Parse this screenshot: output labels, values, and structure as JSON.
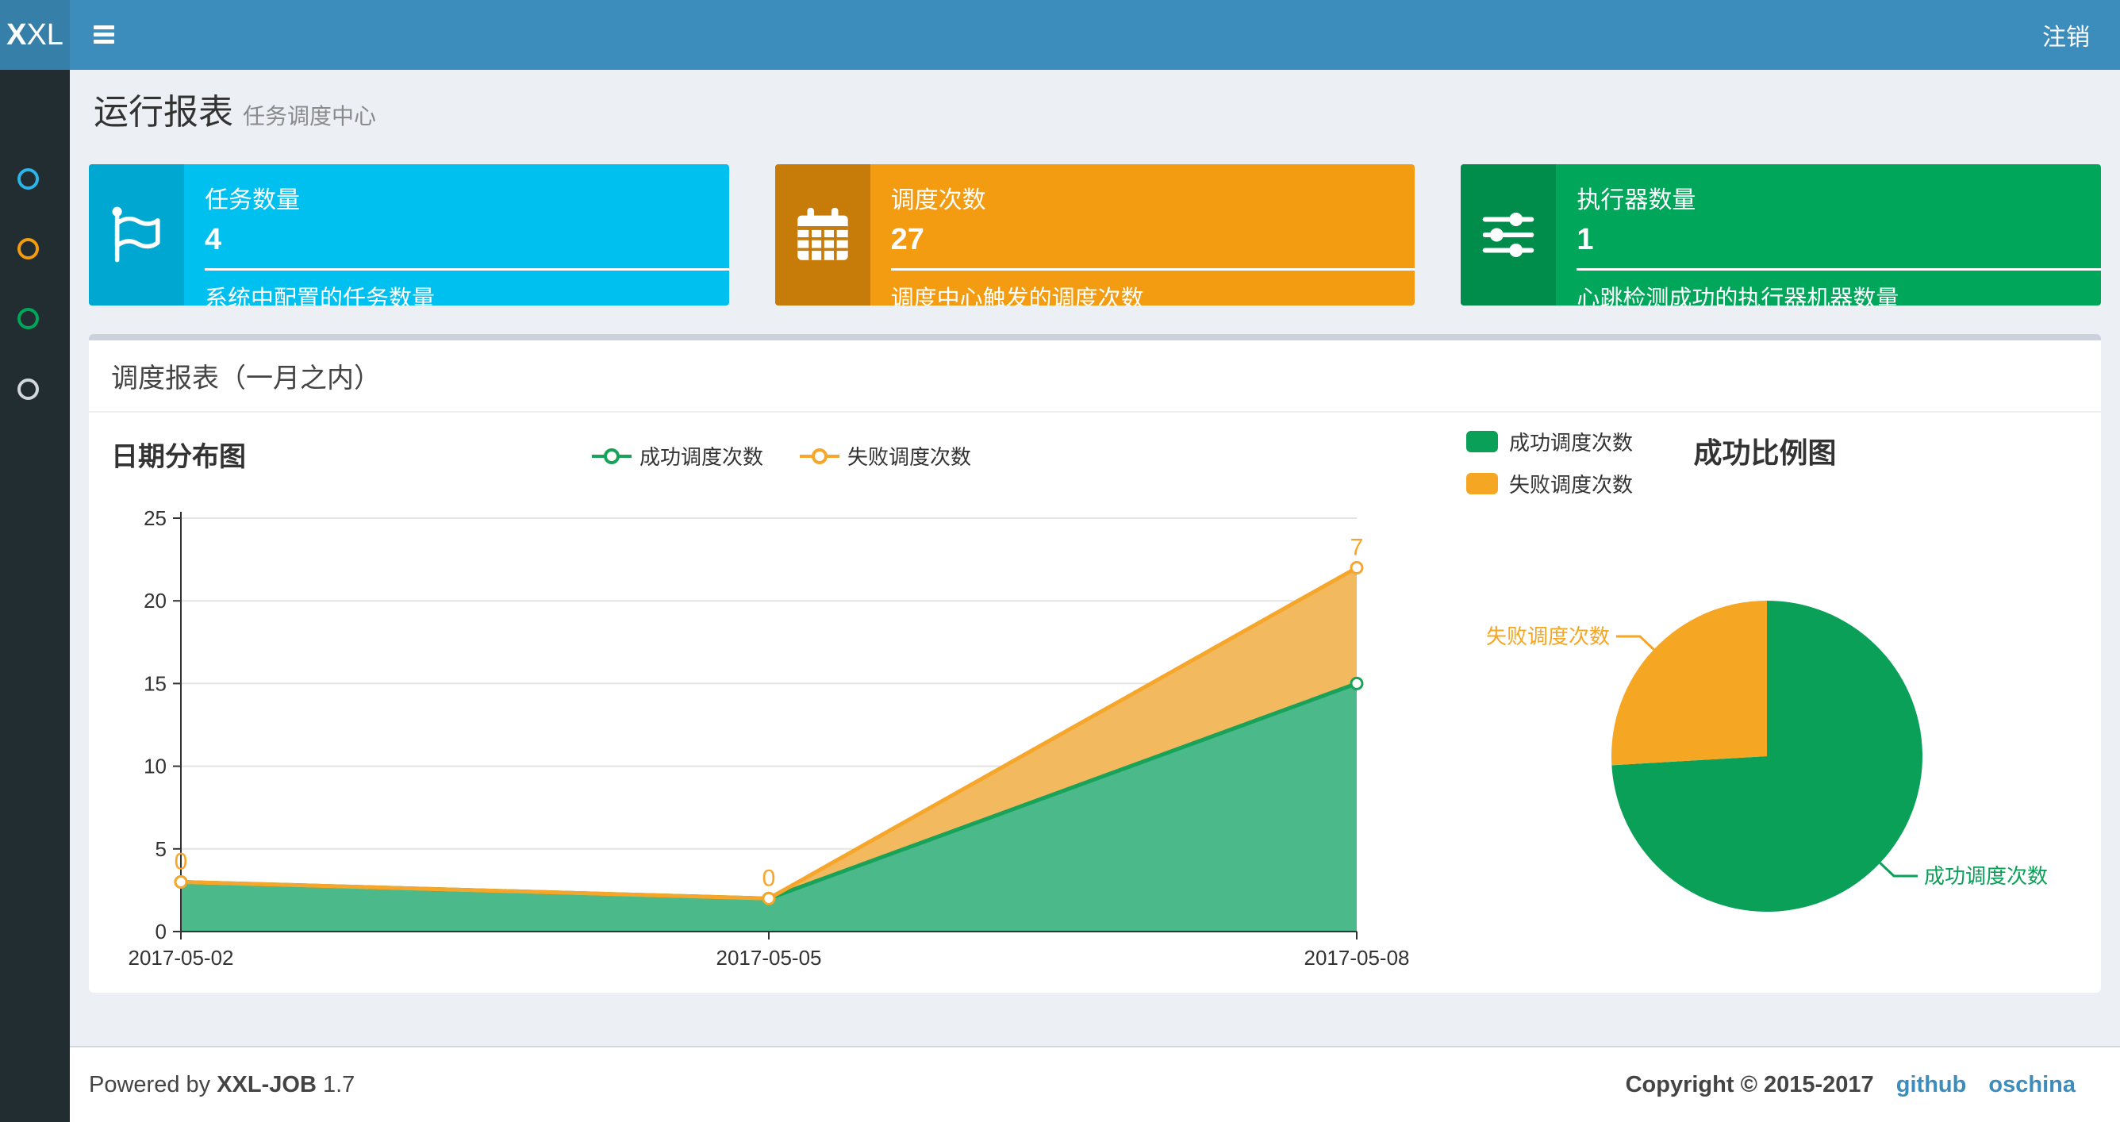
{
  "navbar": {
    "logo_bold": "X",
    "logo_rest": "XL",
    "logout_label": "注销"
  },
  "sidebar": {
    "items": [
      {
        "name": "menu-item-1",
        "color": "#2cb4e8"
      },
      {
        "name": "menu-item-2",
        "color": "#f39c12"
      },
      {
        "name": "menu-item-3",
        "color": "#00a65a"
      },
      {
        "name": "menu-item-4",
        "color": "#d2d6de"
      }
    ]
  },
  "page": {
    "title": "运行报表",
    "subtitle": "任务调度中心"
  },
  "info_boxes": [
    {
      "icon": "flag-icon",
      "label": "任务数量",
      "value": "4",
      "desc": "系统中配置的任务数量",
      "color": "#00c0ef",
      "icon_bg": "#00a7d0"
    },
    {
      "icon": "calendar-icon",
      "label": "调度次数",
      "value": "27",
      "desc": "调度中心触发的调度次数",
      "color": "#f39c12",
      "icon_bg": "#c77c0a"
    },
    {
      "icon": "sliders-icon",
      "label": "执行器数量",
      "value": "1",
      "desc": "心跳检测成功的执行器机器数量",
      "color": "#00a65a",
      "icon_bg": "#008d4c"
    }
  ],
  "panel": {
    "title": "调度报表（一月之内）"
  },
  "chart_data": [
    {
      "type": "area",
      "title": "日期分布图",
      "x": [
        "2017-05-02",
        "2017-05-05",
        "2017-05-08"
      ],
      "stacked": true,
      "series": [
        {
          "name": "成功调度次数",
          "values": [
            3,
            2,
            15
          ],
          "color": "#19a35a",
          "area_color": "#4cb98b"
        },
        {
          "name": "失败调度次数",
          "values": [
            0,
            0,
            7
          ],
          "color": "#f5a62b",
          "area_color": "#f2b95f"
        }
      ],
      "point_labels": [
        {
          "series": "失败调度次数",
          "labels": [
            "0",
            "0",
            "7"
          ]
        }
      ],
      "ylim": [
        0,
        25
      ],
      "yticks": [
        0,
        5,
        10,
        15,
        20,
        25
      ],
      "grid": true,
      "legend_position": "top-center"
    },
    {
      "type": "pie",
      "title": "成功比例图",
      "slices": [
        {
          "name": "成功调度次数",
          "value": 20,
          "color": "#0aa058"
        },
        {
          "name": "失败调度次数",
          "value": 7,
          "color": "#f5a623"
        }
      ],
      "legend_position": "top-left",
      "label_lines": true
    }
  ],
  "footer": {
    "powered_prefix": "Powered by",
    "product": "XXL-JOB",
    "version": "1.7",
    "copyright": "Copyright © 2015-2017",
    "links": [
      {
        "label": "github"
      },
      {
        "label": "oschina"
      }
    ],
    "link_color": "#3c8dbc"
  }
}
